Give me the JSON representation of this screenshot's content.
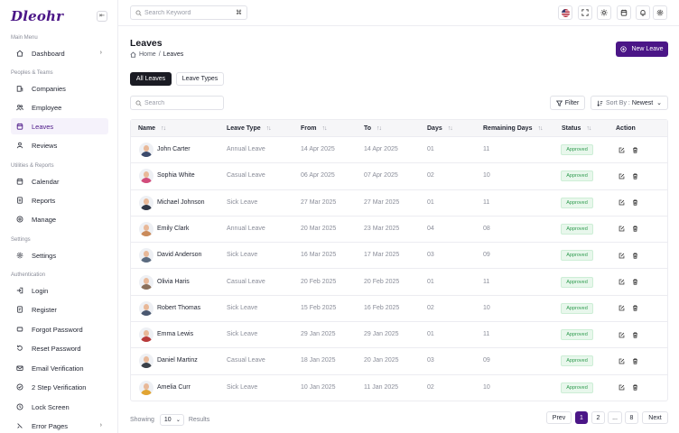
{
  "app": {
    "logo": "Dleohr"
  },
  "sidebar": {
    "sections": [
      {
        "title": "Main Menu"
      },
      {
        "title": "Peoples & Teams"
      },
      {
        "title": "Utilities & Reports"
      },
      {
        "title": "Settings"
      },
      {
        "title": "Authentication"
      }
    ],
    "items": [
      {
        "label": "Dashboard",
        "icon": "home-icon",
        "chevron": "›"
      },
      {
        "label": "Companies",
        "icon": "building-icon"
      },
      {
        "label": "Employee",
        "icon": "users-icon"
      },
      {
        "label": "Leaves",
        "icon": "calendar-leave-icon",
        "active": true
      },
      {
        "label": "Reviews",
        "icon": "user-icon"
      },
      {
        "label": "Calendar",
        "icon": "calendar-icon"
      },
      {
        "label": "Reports",
        "icon": "report-icon"
      },
      {
        "label": "Manage",
        "icon": "manage-icon"
      },
      {
        "label": "Settings",
        "icon": "gear-icon"
      },
      {
        "label": "Login",
        "icon": "login-icon"
      },
      {
        "label": "Register",
        "icon": "register-icon"
      },
      {
        "label": "Forgot Password",
        "icon": "forgot-password-icon"
      },
      {
        "label": "Reset Password",
        "icon": "reset-icon"
      },
      {
        "label": "Email Verification",
        "icon": "mail-icon"
      },
      {
        "label": "2 Step Verification",
        "icon": "verify-icon"
      },
      {
        "label": "Lock Screen",
        "icon": "lock-icon"
      },
      {
        "label": "Error Pages",
        "icon": "error-icon",
        "chevron": "›"
      }
    ]
  },
  "topbar": {
    "search_placeholder": "Search Keyword",
    "shortcut": "⌘",
    "icons": [
      "flag-us-icon",
      "fullscreen-icon",
      "sun-icon",
      "calendar-icon",
      "bell-icon",
      "gear-icon"
    ]
  },
  "page": {
    "title": "Leaves",
    "breadcrumb_home": "Home",
    "breadcrumb_sep": "/",
    "breadcrumb_current": "Leaves",
    "new_button": "New Leave",
    "accent": "#4b1687"
  },
  "tabs": [
    {
      "label": "All Leaves",
      "active": true
    },
    {
      "label": "Leave Types",
      "active": false
    }
  ],
  "toolbar": {
    "search_placeholder": "Search",
    "filter_label": "Filter",
    "sort_label": "Sort By :",
    "sort_value": "Newest"
  },
  "table": {
    "columns": [
      "Name",
      "Leave Type",
      "From",
      "To",
      "Days",
      "Remaining Days",
      "Status",
      "Action"
    ],
    "rows": [
      {
        "name": "John Carter",
        "type": "Annual Leave",
        "from": "14 Apr 2025",
        "to": "14 Apr 2025",
        "days": "01",
        "remaining": "11",
        "status": "Approved"
      },
      {
        "name": "Sophia White",
        "type": "Casual Leave",
        "from": "06 Apr 2025",
        "to": "07 Apr 2025",
        "days": "02",
        "remaining": "10",
        "status": "Approved"
      },
      {
        "name": "Michael Johnson",
        "type": "Sick Leave",
        "from": "27 Mar 2025",
        "to": "27 Mar 2025",
        "days": "01",
        "remaining": "11",
        "status": "Approved"
      },
      {
        "name": "Emily Clark",
        "type": "Annual Leave",
        "from": "20 Mar 2025",
        "to": "23 Mar 2025",
        "days": "04",
        "remaining": "08",
        "status": "Approved"
      },
      {
        "name": "David Anderson",
        "type": "Sick Leave",
        "from": "16 Mar 2025",
        "to": "17 Mar 2025",
        "days": "03",
        "remaining": "09",
        "status": "Approved"
      },
      {
        "name": "Olivia Haris",
        "type": "Casual Leave",
        "from": "20 Feb 2025",
        "to": "20 Feb 2025",
        "days": "01",
        "remaining": "11",
        "status": "Approved"
      },
      {
        "name": "Robert Thomas",
        "type": "Sick Leave",
        "from": "15 Feb 2025",
        "to": "16 Feb 2025",
        "days": "02",
        "remaining": "10",
        "status": "Approved"
      },
      {
        "name": "Emma Lewis",
        "type": "Sick Leave",
        "from": "29 Jan 2025",
        "to": "29 Jan 2025",
        "days": "01",
        "remaining": "11",
        "status": "Approved"
      },
      {
        "name": "Daniel Martinz",
        "type": "Casual Leave",
        "from": "18 Jan 2025",
        "to": "20 Jan 2025",
        "days": "03",
        "remaining": "09",
        "status": "Approved"
      },
      {
        "name": "Amelia Curr",
        "type": "Sick Leave",
        "from": "10 Jan 2025",
        "to": "11 Jan 2025",
        "days": "02",
        "remaining": "10",
        "status": "Approved"
      }
    ]
  },
  "footer": {
    "showing": "Showing",
    "per_page": "10",
    "results": "Results",
    "prev": "Prev",
    "pages": [
      "1",
      "2",
      "...",
      "8"
    ],
    "next": "Next"
  }
}
